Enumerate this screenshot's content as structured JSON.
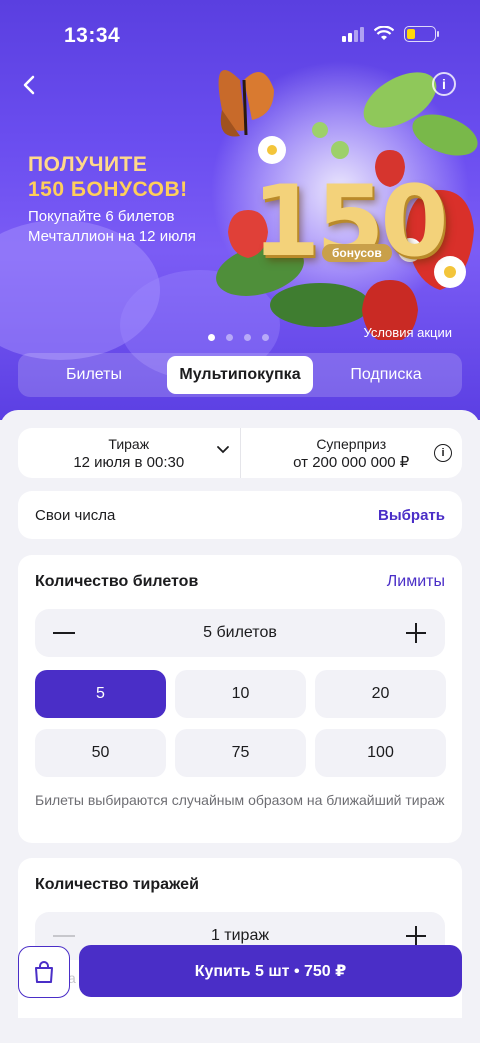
{
  "status_bar": {
    "time": "13:34"
  },
  "hero": {
    "title_line1": "ПОЛУЧИТЕ",
    "title_line2": "150 БОНУСОВ!",
    "subtitle": "Покупайте 6 билетов Мечталлион на 12 июля",
    "big_number": "150",
    "bonus_label": "бонусов",
    "conditions_link": "Условия акции",
    "slides_total": 4,
    "slide_active": 1
  },
  "tabs": [
    {
      "label": "Билеты",
      "active": false
    },
    {
      "label": "Мультипокупка",
      "active": true
    },
    {
      "label": "Подписка",
      "active": false
    }
  ],
  "draw": {
    "label": "Тираж",
    "value": "12 июля в 00:30",
    "prize_label": "Суперприз",
    "prize_value": "от 200 000 000 ₽"
  },
  "own_numbers": {
    "label": "Свои числа",
    "action": "Выбрать"
  },
  "tickets": {
    "title": "Количество билетов",
    "limits_link": "Лимиты",
    "stepper_value": "5 билетов",
    "options": [
      "5",
      "10",
      "20",
      "50",
      "75",
      "100"
    ],
    "selected": "5",
    "note": "Билеты выбираются случайным образом на ближайший тираж"
  },
  "draws": {
    "title": "Количество тиражей",
    "stepper_value": "1 тираж"
  },
  "buy_button": "Купить 5 шт • 750 ₽",
  "partial_text": "а",
  "colors": {
    "accent": "#4a2ec7",
    "hero_bg": "#6b4ef0",
    "promo_gold": "#ffd98a"
  }
}
